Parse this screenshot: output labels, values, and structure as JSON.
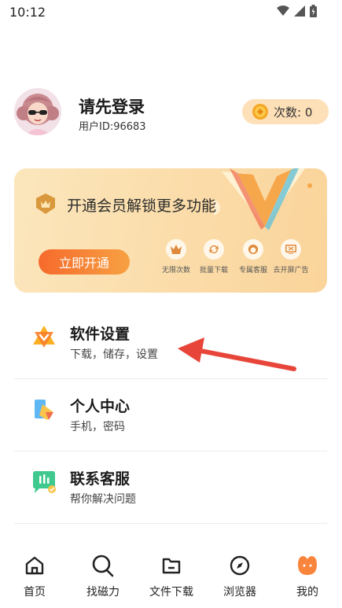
{
  "status_bar": {
    "time": "10:12",
    "icons": [
      "wifi-icon",
      "signal-icon",
      "battery-icon"
    ]
  },
  "profile": {
    "name": "请先登录",
    "user_id": "用户ID:96683",
    "count_label": "次数: 0",
    "avatar": "girl-with-sunglasses-avatar"
  },
  "vip_card": {
    "title": "开通会员解锁更多功能",
    "button": "立即开通",
    "benefits": [
      {
        "label": "无限次数",
        "icon": "crown-icon"
      },
      {
        "label": "批量下载",
        "icon": "refresh-icon"
      },
      {
        "label": "专属客服",
        "icon": "service-icon"
      },
      {
        "label": "去开屏广告",
        "icon": "ad-icon"
      }
    ]
  },
  "menu": [
    {
      "title": "软件设置",
      "subtitle": "下载，储存，设置",
      "icon": "settings-icon"
    },
    {
      "title": "个人中心",
      "subtitle": "手机，密码",
      "icon": "profile-card-icon"
    },
    {
      "title": "联系客服",
      "subtitle": "帮你解决问题",
      "icon": "chat-icon"
    }
  ],
  "tabs": [
    {
      "label": "首页",
      "icon": "home-icon"
    },
    {
      "label": "找磁力",
      "icon": "search-icon"
    },
    {
      "label": "文件下载",
      "icon": "folder-icon"
    },
    {
      "label": "浏览器",
      "icon": "compass-icon"
    },
    {
      "label": "我的",
      "icon": "mine-icon",
      "active": true
    }
  ],
  "colors": {
    "accent": "#f66a2c",
    "card_bg": "#fbdca9",
    "pill_bg": "#fde0b8"
  }
}
